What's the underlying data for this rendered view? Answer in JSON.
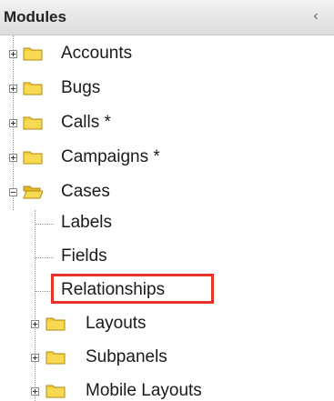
{
  "header": {
    "title": "Modules",
    "collapse_glyph": "‹"
  },
  "tree": {
    "modules": [
      {
        "label": "Accounts",
        "expanded": false
      },
      {
        "label": "Bugs",
        "expanded": false
      },
      {
        "label": "Calls *",
        "expanded": false
      },
      {
        "label": "Campaigns *",
        "expanded": false
      },
      {
        "label": "Cases",
        "expanded": true
      }
    ],
    "cases_children": [
      {
        "label": "Labels",
        "type": "leaf"
      },
      {
        "label": "Fields",
        "type": "leaf"
      },
      {
        "label": "Relationships",
        "type": "leaf",
        "highlighted": true
      },
      {
        "label": "Layouts",
        "type": "folder"
      },
      {
        "label": "Subpanels",
        "type": "folder"
      },
      {
        "label": "Mobile Layouts",
        "type": "folder"
      }
    ]
  },
  "colors": {
    "folder_fill": "#f3cd3b",
    "folder_edge": "#b38a12",
    "highlight": "#e8312a"
  },
  "icons": {
    "closed_folder": "closed-folder-icon",
    "open_folder": "open-folder-icon",
    "expand": "plus-expander-icon",
    "collapse": "minus-expander-icon"
  }
}
